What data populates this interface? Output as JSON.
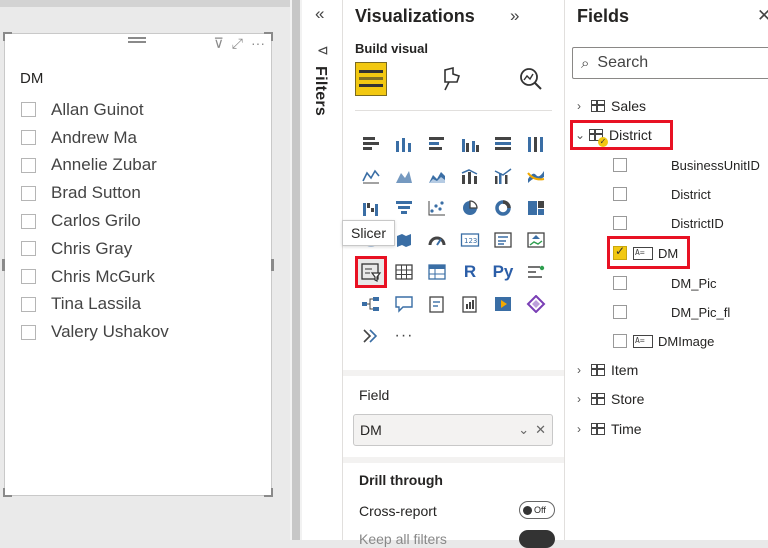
{
  "slicer": {
    "title": "DM",
    "items": [
      "Allan Guinot",
      "Andrew Ma",
      "Annelie Zubar",
      "Brad Sutton",
      "Carlos Grilo",
      "Chris Gray",
      "Chris McGurk",
      "Tina Lassila",
      "Valery Ushakov"
    ],
    "tools": {
      "filter": "⊽",
      "focus": "⤢",
      "more": "···"
    }
  },
  "filters": {
    "label": "Filters",
    "collapse": "«",
    "icon": "⊲"
  },
  "visualizations": {
    "title": "Visualizations",
    "expand": "»",
    "build_visual": "Build visual",
    "tooltip": "Slicer",
    "more": "···",
    "python_label": "Py",
    "r_label": "R",
    "field_label": "Field",
    "field_value": "DM",
    "drill_through": "Drill through",
    "cross_report": "Cross-report",
    "toggle_off": "Off",
    "keep_all_filters": "Keep all filters"
  },
  "fields": {
    "title": "Fields",
    "close": "✕",
    "search_placeholder": "Search",
    "tables": [
      {
        "name": "Sales"
      },
      {
        "name": "District"
      },
      {
        "name": "Item"
      },
      {
        "name": "Store"
      },
      {
        "name": "Time"
      }
    ],
    "district_fields": [
      "BusinessUnitID",
      "District",
      "DistrictID",
      "DM",
      "DM_Pic",
      "DM_Pic_fl",
      "DMImage"
    ]
  },
  "colors": {
    "accent_yellow": "#f2c811",
    "highlight_red": "#e81123"
  }
}
